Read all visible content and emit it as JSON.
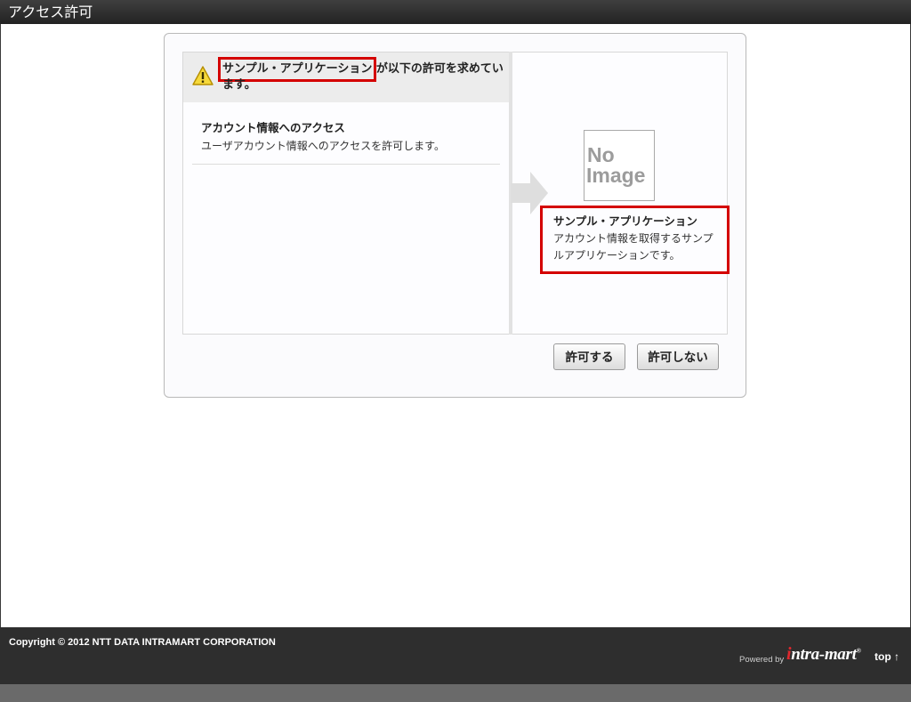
{
  "window": {
    "title": "アクセス許可"
  },
  "request": {
    "app_name": "サンプル・アプリケーション",
    "message_suffix": "が以下の許可を求めています。"
  },
  "scopes": [
    {
      "title": "アカウント情報へのアクセス",
      "description": "ユーザアカウント情報へのアクセスを許可します。"
    }
  ],
  "application": {
    "image_text": [
      "No",
      "Image"
    ],
    "name": "サンプル・アプリケーション",
    "description": "アカウント情報を取得するサンプルアプリケーションです。"
  },
  "buttons": {
    "allow": "許可する",
    "deny": "許可しない"
  },
  "footer": {
    "copyright": "Copyright © 2012 NTT DATA INTRAMART CORPORATION",
    "powered_by": "Powered by",
    "logo_initial": "i",
    "logo_rest": "ntra-mart",
    "logo_reg": "®",
    "top_link": "top ↑"
  },
  "colors": {
    "highlight": "#d40000",
    "header_bg": "#2b2b2b",
    "footer_bg": "#2e2e2e"
  },
  "icons": [
    "warning-icon",
    "arrow-right-icon",
    "no-image-placeholder"
  ]
}
